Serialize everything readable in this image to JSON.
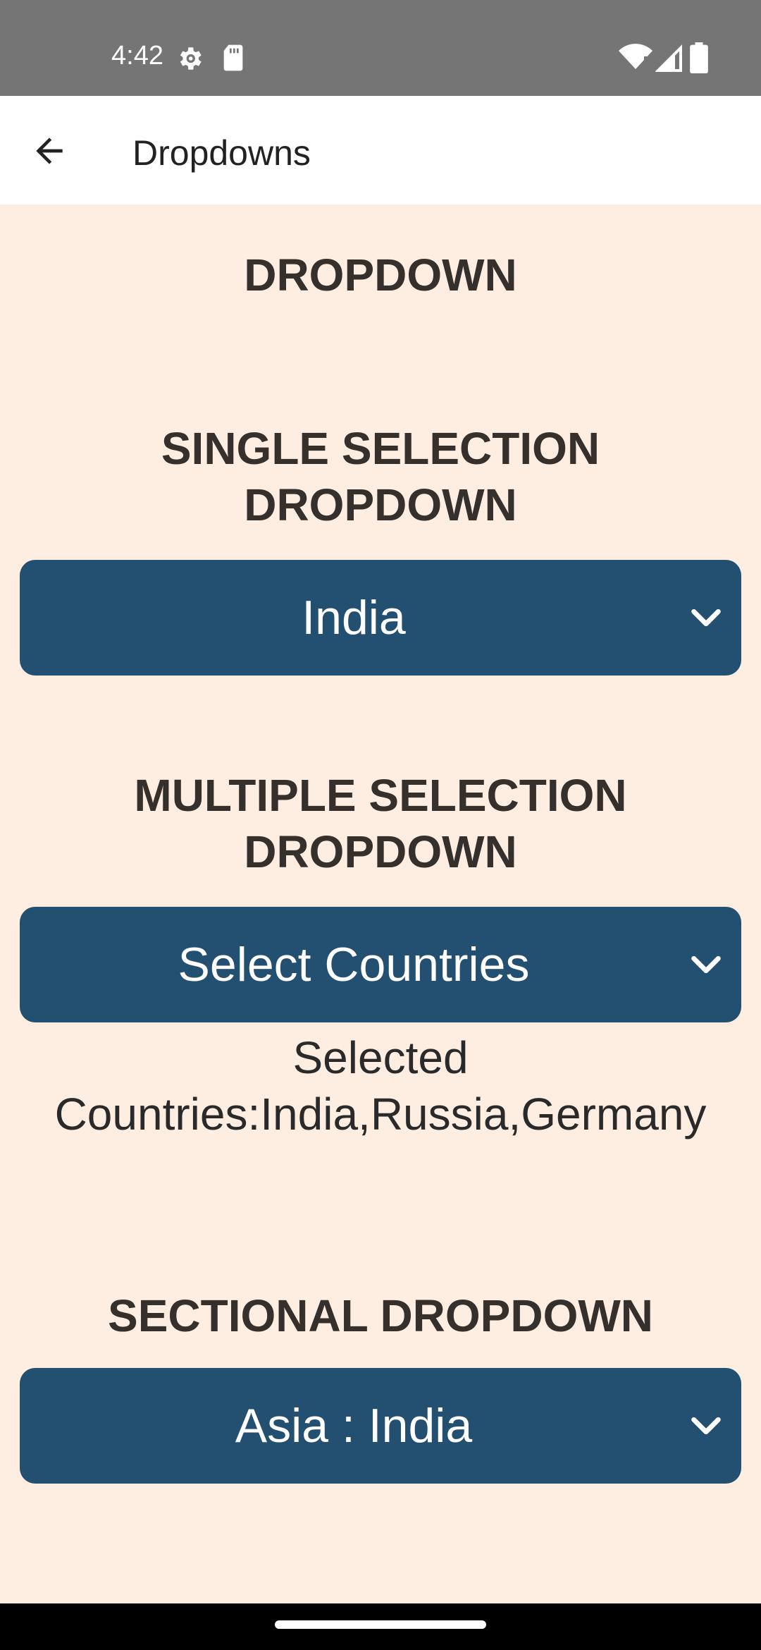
{
  "status_bar": {
    "time": "4:42",
    "icons": [
      "settings-icon",
      "sd-card-icon",
      "wifi-icon",
      "cell-signal-icon",
      "battery-icon"
    ]
  },
  "app_bar": {
    "title": "Dropdowns",
    "back_icon": "arrow-back-icon"
  },
  "page": {
    "main_heading": "DROPDOWN",
    "single": {
      "heading_line1": "SINGLE SELECTION",
      "heading_line2": "DROPDOWN",
      "value": "India"
    },
    "multiple": {
      "heading_line1": "MULTIPLE SELECTION",
      "heading_line2": "DROPDOWN",
      "placeholder": "Select Countries",
      "selected_line1": "Selected",
      "selected_line2": "Countries:India,Russia,Germany"
    },
    "sectional": {
      "heading": "SECTIONAL DROPDOWN",
      "value": "Asia : India"
    }
  },
  "colors": {
    "background": "#fdeee1",
    "dropdown": "#234f71",
    "heading_text": "#35302c",
    "status_bar": "#757575"
  }
}
